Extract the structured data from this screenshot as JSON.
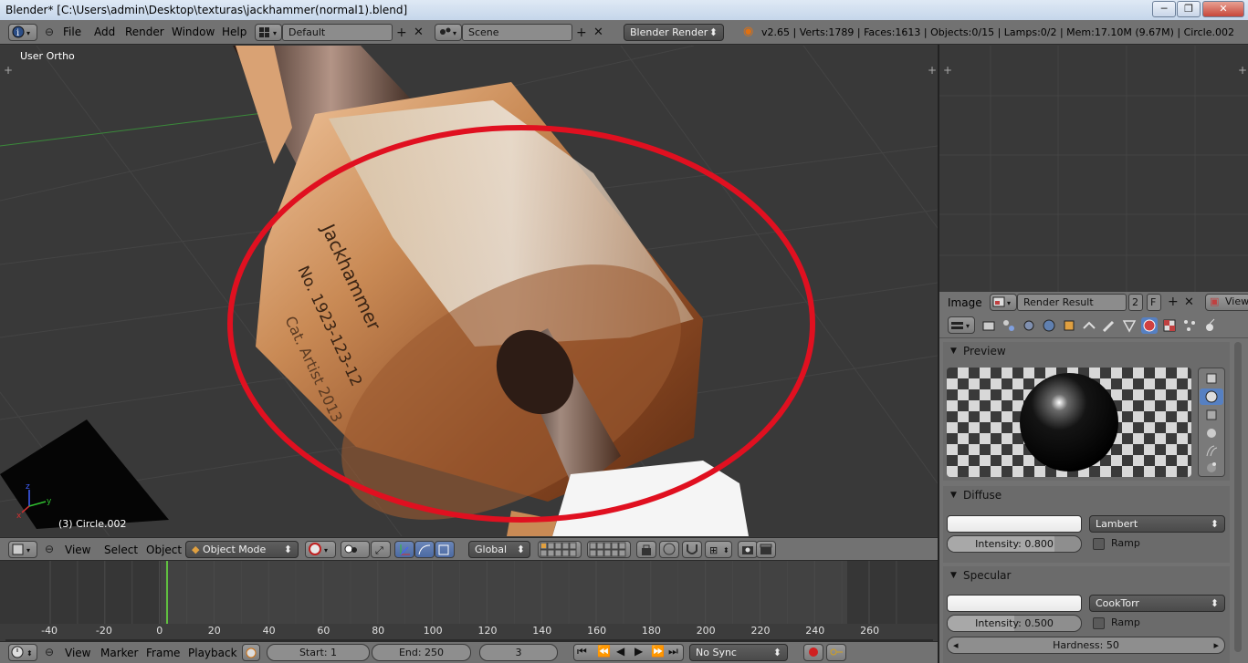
{
  "window": {
    "title": "Blender* [C:\\Users\\admin\\Desktop\\texturas\\jackhammer(normal1).blend]",
    "min_label": "─",
    "max_label": "❐",
    "close_label": "✕"
  },
  "info_header": {
    "menus": [
      "File",
      "Add",
      "Render",
      "Window",
      "Help"
    ],
    "layout_value": "Default",
    "scene_value": "Scene",
    "engine_value": "Blender Render",
    "stats": "v2.65 | Verts:1789 | Faces:1613 | Objects:0/15 | Lamps:0/2 | Mem:17.10M (9.67M) | Circle.002"
  },
  "viewport": {
    "view_label": "User Ortho",
    "object_label": "(3) Circle.002",
    "engraving": [
      "Jackhammer",
      "No. 1923-123-12",
      "Cat. Artist 2013"
    ]
  },
  "view3d_header": {
    "menus": [
      "View",
      "Select",
      "Object"
    ],
    "mode_value": "Object Mode",
    "orientation_value": "Global"
  },
  "timeline": {
    "ticks": [
      "-40",
      "-20",
      "0",
      "20",
      "40",
      "60",
      "80",
      "100",
      "120",
      "140",
      "160",
      "180",
      "200",
      "220",
      "240",
      "260"
    ],
    "current_frame": 3
  },
  "bottom_header": {
    "menus": [
      "View",
      "Marker",
      "Frame",
      "Playback"
    ],
    "start_label": "Start: 1",
    "end_label": "End: 250",
    "frame_value": "3",
    "sync_value": "No Sync"
  },
  "image_header": {
    "menu": "Image",
    "image_name": "Render Result",
    "users": "2",
    "fake": "F",
    "view_menu": "View"
  },
  "properties": {
    "preview_title": "Preview",
    "diffuse_title": "Diffuse",
    "diffuse_shader": "Lambert",
    "diffuse_intensity": "Intensity: 0.800",
    "diffuse_intensity_value": 0.8,
    "ramp_label": "Ramp",
    "specular_title": "Specular",
    "specular_shader": "CookTorr",
    "specular_intensity": "Intensity: 0.500",
    "specular_intensity_value": 0.5,
    "hardness": "Hardness: 50"
  },
  "colors": {
    "highlight_circle": "#e01020",
    "x_axis": "#d03030",
    "y_axis": "#30c030",
    "z_axis": "#4060ff",
    "frame_cursor": "#60c040"
  }
}
